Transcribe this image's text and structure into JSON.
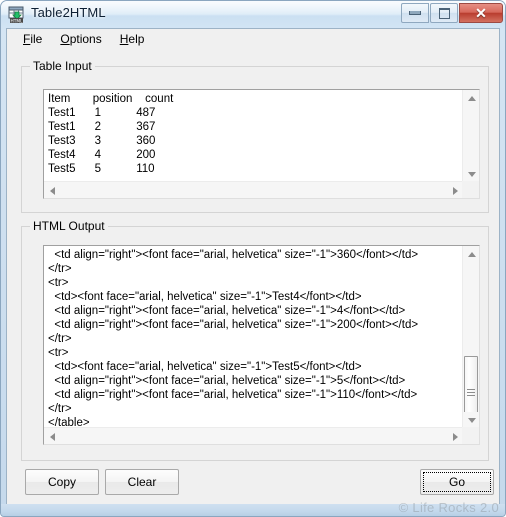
{
  "window": {
    "title": "Table2HTML",
    "app_icon": "table-to-html-icon",
    "controls": {
      "minimize": "minimize-icon",
      "maximize": "maximize-icon",
      "close": "✕"
    }
  },
  "menubar": {
    "items": [
      {
        "label": "File",
        "accel": "F"
      },
      {
        "label": "Options",
        "accel": "O"
      },
      {
        "label": "Help",
        "accel": "H"
      }
    ]
  },
  "table_input": {
    "legend": "Table Input",
    "text": "Item       position    count\nTest1      1           487\nTest1      2           367\nTest3      3           360\nTest4      4           200\nTest5      5           110",
    "rows": [
      {
        "item": "Item",
        "position": "position",
        "count": "count",
        "header": true
      },
      {
        "item": "Test1",
        "position": "1",
        "count": "487"
      },
      {
        "item": "Test1",
        "position": "2",
        "count": "367"
      },
      {
        "item": "Test3",
        "position": "3",
        "count": "360"
      },
      {
        "item": "Test4",
        "position": "4",
        "count": "200"
      },
      {
        "item": "Test5",
        "position": "5",
        "count": "110"
      }
    ],
    "scrollbar_v": "vertical-scrollbar",
    "scrollbar_h": "horizontal-scrollbar"
  },
  "html_output": {
    "legend": "HTML Output",
    "text": "  <td align=\"right\"><font face=\"arial, helvetica\" size=\"-1\">360</font></td>\n</tr>\n<tr>\n  <td><font face=\"arial, helvetica\" size=\"-1\">Test4</font></td>\n  <td align=\"right\"><font face=\"arial, helvetica\" size=\"-1\">4</font></td>\n  <td align=\"right\"><font face=\"arial, helvetica\" size=\"-1\">200</font></td>\n</tr>\n<tr>\n  <td><font face=\"arial, helvetica\" size=\"-1\">Test5</font></td>\n  <td align=\"right\"><font face=\"arial, helvetica\" size=\"-1\">5</font></td>\n  <td align=\"right\"><font face=\"arial, helvetica\" size=\"-1\">110</font></td>\n</tr>\n</table>",
    "scrollbar_v": "vertical-scrollbar",
    "scrollbar_h": "horizontal-scrollbar"
  },
  "buttons": {
    "copy": "Copy",
    "clear": "Clear",
    "go": "Go"
  },
  "watermark": "© Life Rocks 2.0",
  "colors": {
    "frame": "#c5d9ec",
    "client": "#f0f0f0",
    "close_button": "#b93c2e",
    "text": "#000000"
  }
}
